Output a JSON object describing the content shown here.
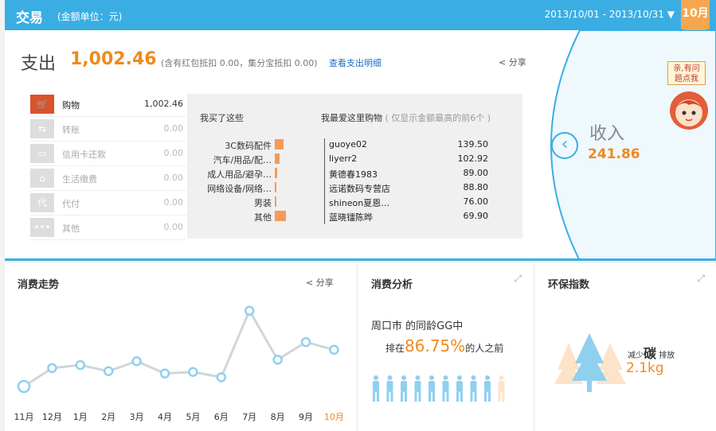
{
  "header": {
    "title": "交易",
    "unit": "(金额单位：元)",
    "date_range": "2013/10/01 - 2013/10/31 ▼",
    "month_tab": "10月"
  },
  "spend": {
    "label": "支出",
    "amount": "1,002.46",
    "note": "(含有红包抵扣 0.00，集分宝抵扣 0.00)",
    "detail_link": "查看支出明细",
    "share": "分享",
    "categories": [
      {
        "icon": "🛒",
        "name": "购物",
        "value": "1,002.46"
      },
      {
        "icon": "⇆",
        "name": "转账",
        "value": "0.00"
      },
      {
        "icon": "▭",
        "name": "信用卡还款",
        "value": "0.00"
      },
      {
        "icon": "⌂",
        "name": "生活缴费",
        "value": "0.00"
      },
      {
        "icon": "代",
        "name": "代付",
        "value": "0.00"
      },
      {
        "icon": "•••",
        "name": "其他",
        "value": "0.00"
      }
    ]
  },
  "bought": {
    "heading": "我买了这些",
    "items": [
      {
        "label": "3C数码配件",
        "share": 0.7
      },
      {
        "label": "汽车/用品/配…",
        "share": 0.4
      },
      {
        "label": "成人用品/避孕…",
        "share": 0.2
      },
      {
        "label": "网络设备/网络…",
        "share": 0.15
      },
      {
        "label": "男装",
        "share": 0.12
      },
      {
        "label": "其他",
        "share": 0.85
      }
    ]
  },
  "favorite": {
    "heading": "我最爱这里购物",
    "note": "( 仅显示金额最高的前6个 )",
    "items": [
      {
        "name": "guoye02",
        "value": "139.50"
      },
      {
        "name": "liyerr2",
        "value": "102.92"
      },
      {
        "name": "黄德春1983",
        "value": "89.00"
      },
      {
        "name": "远诺数码专营店",
        "value": "88.80"
      },
      {
        "name": "shineon夏恩…",
        "value": "76.00"
      },
      {
        "name": "蓝晓镭陈晔",
        "value": "69.90"
      }
    ]
  },
  "income": {
    "label": "收入",
    "amount": "241.86"
  },
  "help": {
    "line1": "亲,有问",
    "line2": "题点我"
  },
  "trend": {
    "title": "消费走势",
    "share": "分享",
    "chart_data": {
      "type": "line",
      "categories": [
        "11月",
        "12月",
        "1月",
        "2月",
        "3月",
        "4月",
        "5月",
        "6月",
        "7月",
        "8月",
        "9月",
        "10月"
      ],
      "values": [
        0,
        240,
        280,
        200,
        330,
        170,
        190,
        120,
        990,
        350,
        580,
        480
      ],
      "ylim": [
        0,
        1050
      ]
    }
  },
  "analysis": {
    "title": "消费分析",
    "line1": "周口市 的同龄GG中",
    "prefix": "排在",
    "percent": "86.75%",
    "suffix": "的人之前",
    "people_highlighted": 9,
    "people_total": 10
  },
  "eco": {
    "title": "环保指数",
    "reduce": "减少",
    "carbon": "碳",
    "emit": "排放",
    "value": "2.1kg"
  },
  "colors": {
    "accent": "#3aaee3",
    "orange": "#f08a1c",
    "bar": "#f59a58",
    "line": "#cfd6da",
    "point": "#8fd0ef"
  }
}
